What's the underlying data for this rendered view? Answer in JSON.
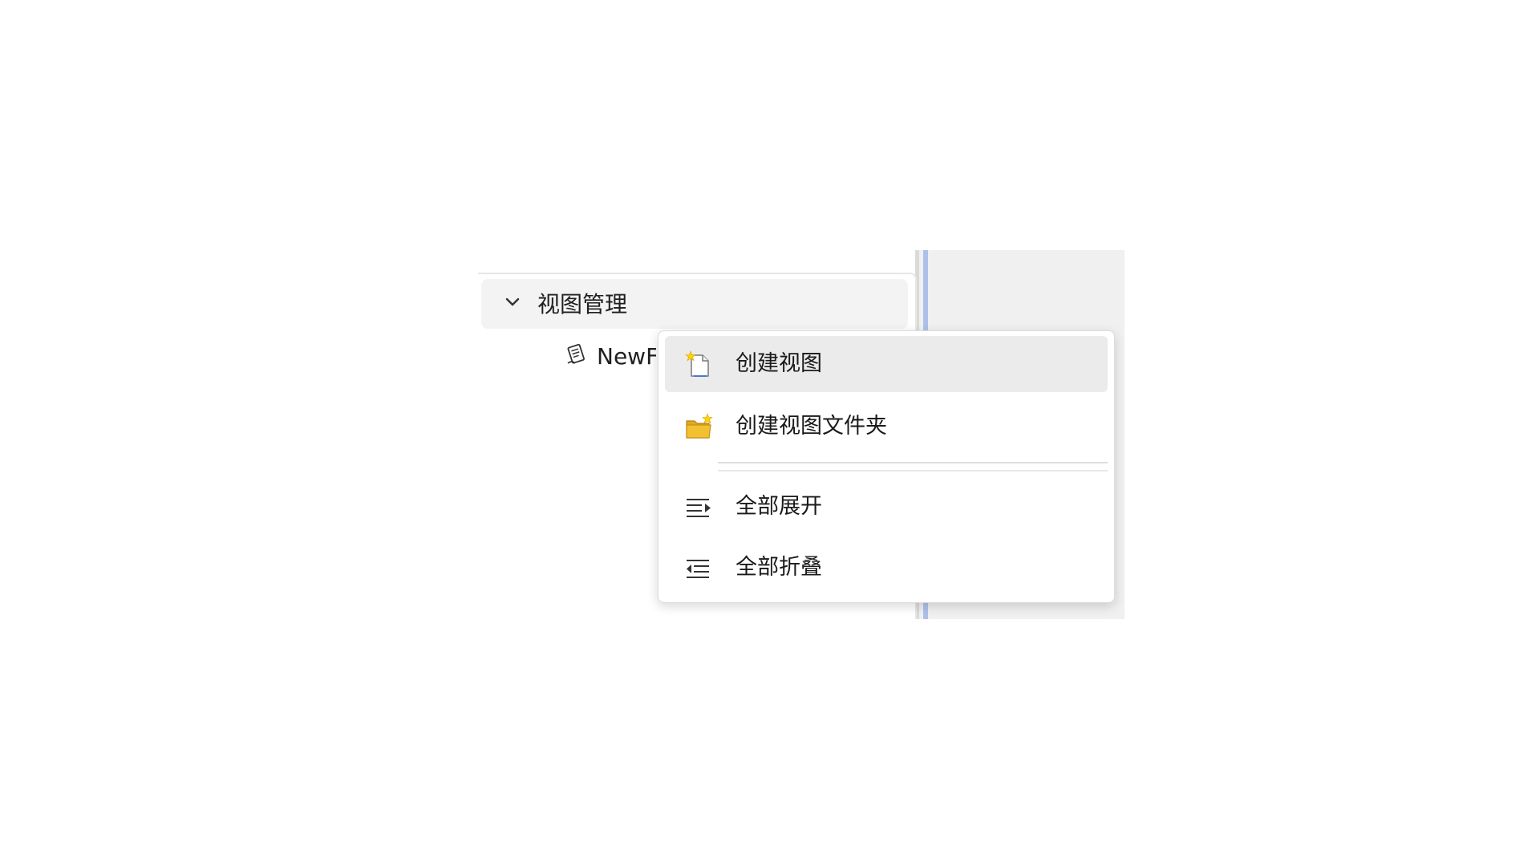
{
  "tree": {
    "header_title": "视图管理",
    "header_icon": "chevron-down-icon",
    "child_label": "NewF",
    "child_icon": "view-document-icon"
  },
  "context_menu": {
    "items": [
      {
        "label": "创建视图",
        "icon": "new-view-icon",
        "highlighted": true
      },
      {
        "label": "创建视图文件夹",
        "icon": "new-folder-icon",
        "highlighted": false
      },
      {
        "label": "全部展开",
        "icon": "expand-all-icon",
        "highlighted": false
      },
      {
        "label": "全部折叠",
        "icon": "collapse-all-icon",
        "highlighted": false
      }
    ]
  },
  "colors": {
    "menu_highlight": "#ebebeb",
    "header_bg": "#f3f3f3",
    "side_pane_bg": "#f0f0f0",
    "splitter_accent": "#aec0ea",
    "folder_yellow": "#f2c132",
    "sparkle": "#ffd400"
  }
}
